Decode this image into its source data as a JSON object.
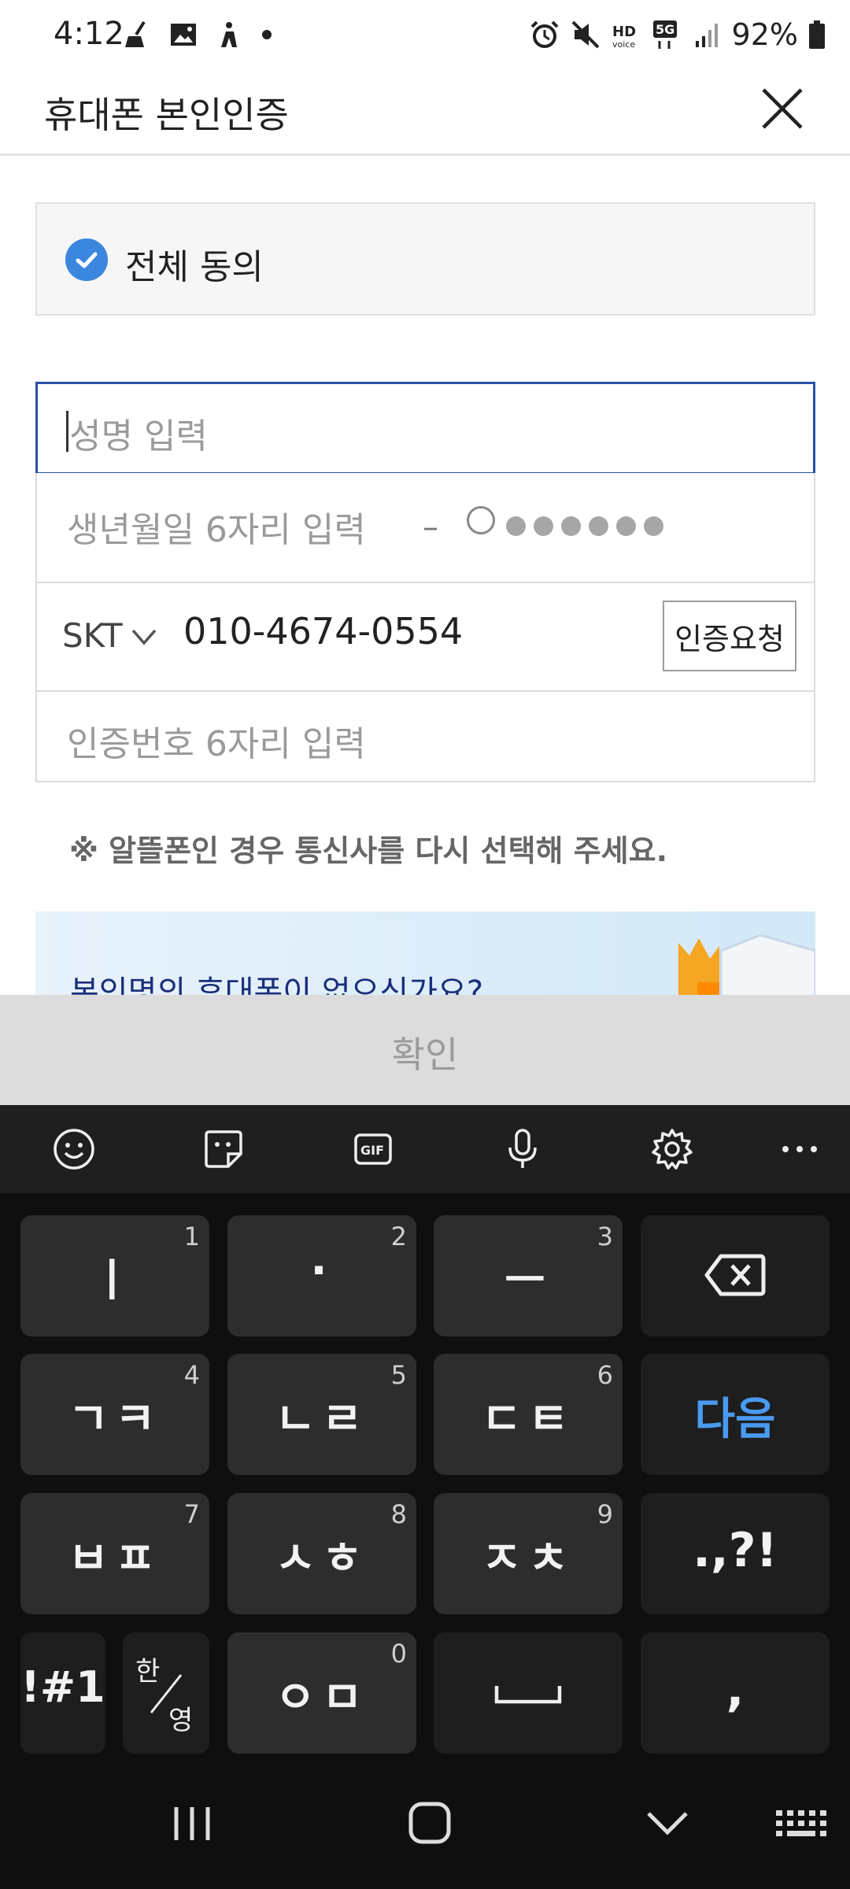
{
  "status_bar": {
    "time": "4:12",
    "battery": "92%",
    "left_icons": [
      "broom-icon",
      "image-icon",
      "accessibility-icon",
      "dot-icon"
    ],
    "right_icons": [
      "alarm-icon",
      "mute-icon",
      "hd-voice-icon",
      "5g-icon",
      "signal-icon",
      "battery-icon"
    ]
  },
  "header": {
    "title": "휴대폰 본인인증",
    "close_icon": "close-icon"
  },
  "agree_all": {
    "label": "전체 동의",
    "checked": true
  },
  "form": {
    "name_placeholder": "성명 입력",
    "birth_placeholder": "생년월일 6자리 입력",
    "birth_dash": "–",
    "carrier": "SKT",
    "phone_number": "010-4674-0554",
    "verify_button": "인증요청",
    "code_placeholder": "인증번호 6자리 입력"
  },
  "notice": "※ 알뜰폰인 경우 통신사를 다시 선택해 주세요.",
  "banner": {
    "text": "본인명의 휴대폰이 없으신가요?"
  },
  "confirm_button": "확인",
  "keyboard": {
    "toolbar": [
      "emoji-icon",
      "sticker-icon",
      "gif-icon",
      "microphone-icon",
      "settings-icon",
      "more-icon"
    ],
    "rows": [
      [
        {
          "label": "ㅣ",
          "num": "1"
        },
        {
          "label": "·",
          "num": "2"
        },
        {
          "label": "ㅡ",
          "num": "3"
        },
        {
          "label": "",
          "icon": "backspace-icon"
        }
      ],
      [
        {
          "label": "ㄱㅋ",
          "num": "4"
        },
        {
          "label": "ㄴㄹ",
          "num": "5"
        },
        {
          "label": "ㄷㅌ",
          "num": "6"
        },
        {
          "label": "다음"
        }
      ],
      [
        {
          "label": "ㅂㅍ",
          "num": "7"
        },
        {
          "label": "ㅅㅎ",
          "num": "8"
        },
        {
          "label": "ㅈㅊ",
          "num": "9"
        },
        {
          "label": ".,?!"
        }
      ],
      [
        {
          "label": "!#1"
        },
        {
          "label": "한/영"
        },
        {
          "label": "ㅇㅁ",
          "num": "0"
        },
        {
          "label": "",
          "icon": "space-icon"
        },
        {
          "label": ","
        }
      ]
    ],
    "key_1": {
      "label": "ㅣ",
      "num": "1"
    },
    "key_2": {
      "label": "·",
      "num": "2"
    },
    "key_3": {
      "label": "ㅡ",
      "num": "3"
    },
    "key_4": {
      "label": "ㄱㅋ",
      "num": "4"
    },
    "key_5": {
      "label": "ㄴㄹ",
      "num": "5"
    },
    "key_6": {
      "label": "ㄷㅌ",
      "num": "6"
    },
    "key_next": "다음",
    "key_7": {
      "label": "ㅂㅍ",
      "num": "7"
    },
    "key_8": {
      "label": "ㅅㅎ",
      "num": "8"
    },
    "key_9": {
      "label": "ㅈㅊ",
      "num": "9"
    },
    "key_punct": ".,?!",
    "key_symbols": "!#1",
    "key_lang_top": "한",
    "key_lang_bottom": "영",
    "key_0": {
      "label": "ㅇㅁ",
      "num": "0"
    },
    "key_comma": ","
  },
  "nav_bar": [
    "recents-icon",
    "home-icon",
    "back-icon",
    "keyboard-icon"
  ]
}
